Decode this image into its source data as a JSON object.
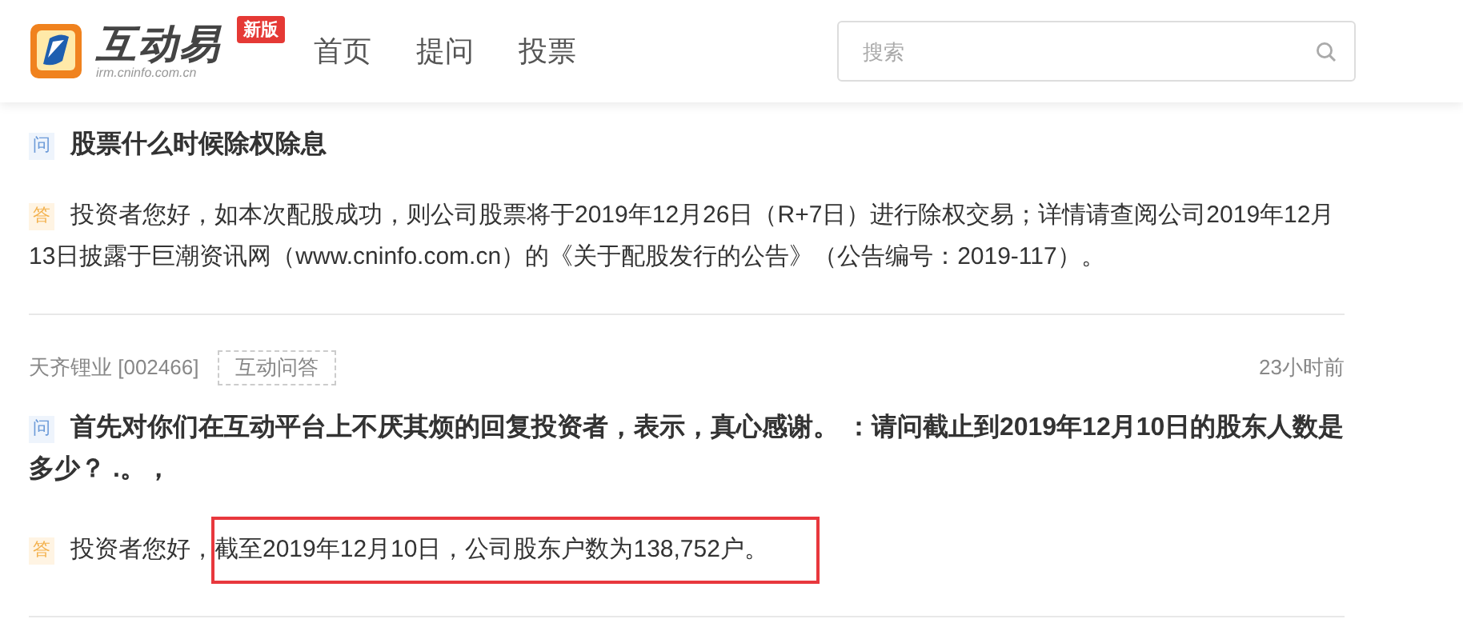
{
  "header": {
    "brand": "互动易",
    "domain": "irm.cninfo.com.cn",
    "badge": "新版",
    "nav": [
      {
        "label": "首页"
      },
      {
        "label": "提问"
      },
      {
        "label": "投票"
      }
    ],
    "search": {
      "placeholder": "搜索"
    }
  },
  "items": [
    {
      "question_mark": "问",
      "question": "股票什么时候除权除息",
      "answer_mark": "答",
      "answer": "投资者您好，如本次配股成功，则公司股票将于2019年12月26日（R+7日）进行除权交易；详情请查阅公司2019年12月13日披露于巨潮资讯网（www.cninfo.com.cn）的《关于配股发行的公告》（公告编号：2019-117）。"
    },
    {
      "company": "天齐锂业 [002466]",
      "tag": "互动问答",
      "time": "23小时前",
      "question_mark": "问",
      "question": "首先对你们在互动平台上不厌其烦的回复投资者，表示，真心感谢。 ：请问截止到2019年12月10日的股东人数是多少？ .。，",
      "answer_mark": "答",
      "answer": "投资者您好，",
      "highlighted": "截至2019年12月10日，公司股东户数为138,752户。"
    }
  ]
}
